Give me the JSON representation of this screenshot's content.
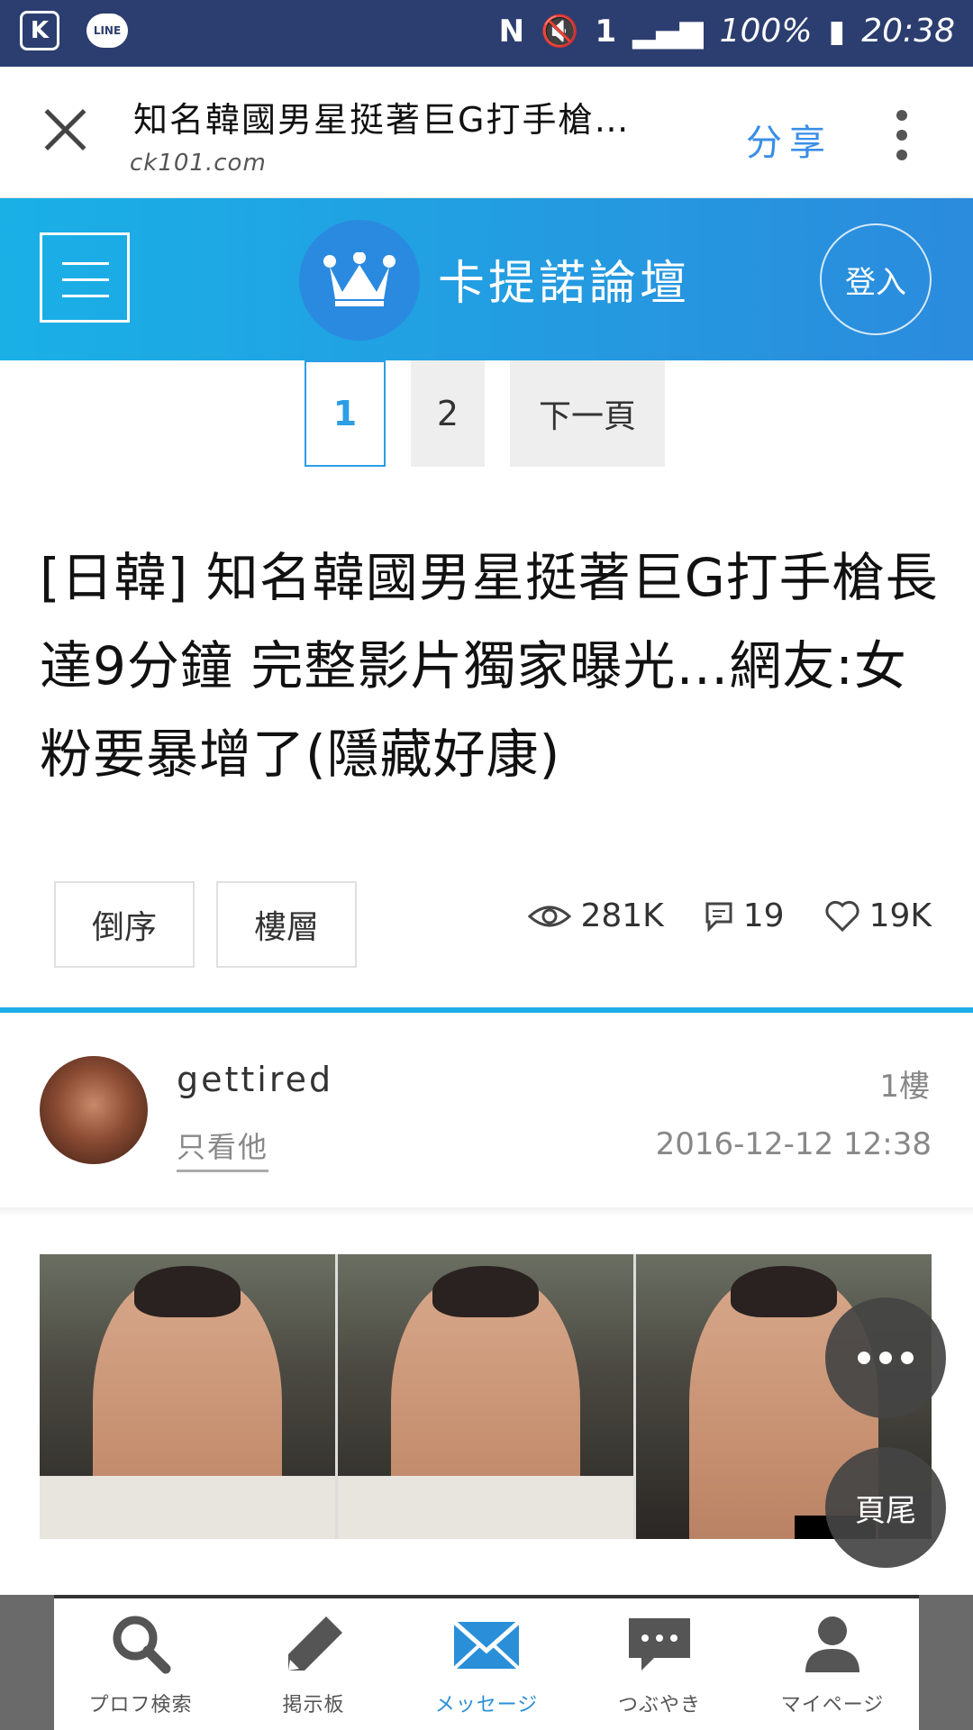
{
  "status_bar": {
    "battery": "100%",
    "time": "20:38",
    "sim": "1"
  },
  "browser": {
    "title": "知名韓國男星挺著巨G打手槍…",
    "url": "ck101.com",
    "share_label": "分享"
  },
  "site": {
    "name": "卡提諾論壇",
    "login_label": "登入"
  },
  "pagination": {
    "pages": [
      "1",
      "2"
    ],
    "next_label": "下一頁"
  },
  "post": {
    "title": "[日韓] 知名韓國男星挺著巨G打手槍長達9分鐘 完整影片獨家曝光…網友:女粉要暴增了(隱藏好康)",
    "sort_reverse": "倒序",
    "sort_floor": "樓層",
    "views": "281K",
    "comments": "19",
    "likes": "19K"
  },
  "author": {
    "username": "gettired",
    "only_him": "只看他",
    "floor": "1樓",
    "time": "2016-12-12 12:38"
  },
  "fab": {
    "bottom_label": "頁尾"
  },
  "nav": {
    "items": [
      {
        "label": "プロフ検索",
        "icon": "search-icon"
      },
      {
        "label": "掲示板",
        "icon": "pencil-icon"
      },
      {
        "label": "メッセージ",
        "icon": "mail-icon"
      },
      {
        "label": "つぶやき",
        "icon": "chat-icon"
      },
      {
        "label": "マイページ",
        "icon": "user-icon"
      }
    ],
    "active_index": 2
  },
  "colors": {
    "accent": "#2b9ee6",
    "banner_start": "#1ab0e6",
    "banner_end": "#2b8bdd",
    "status_bar": "#2c3e70"
  }
}
